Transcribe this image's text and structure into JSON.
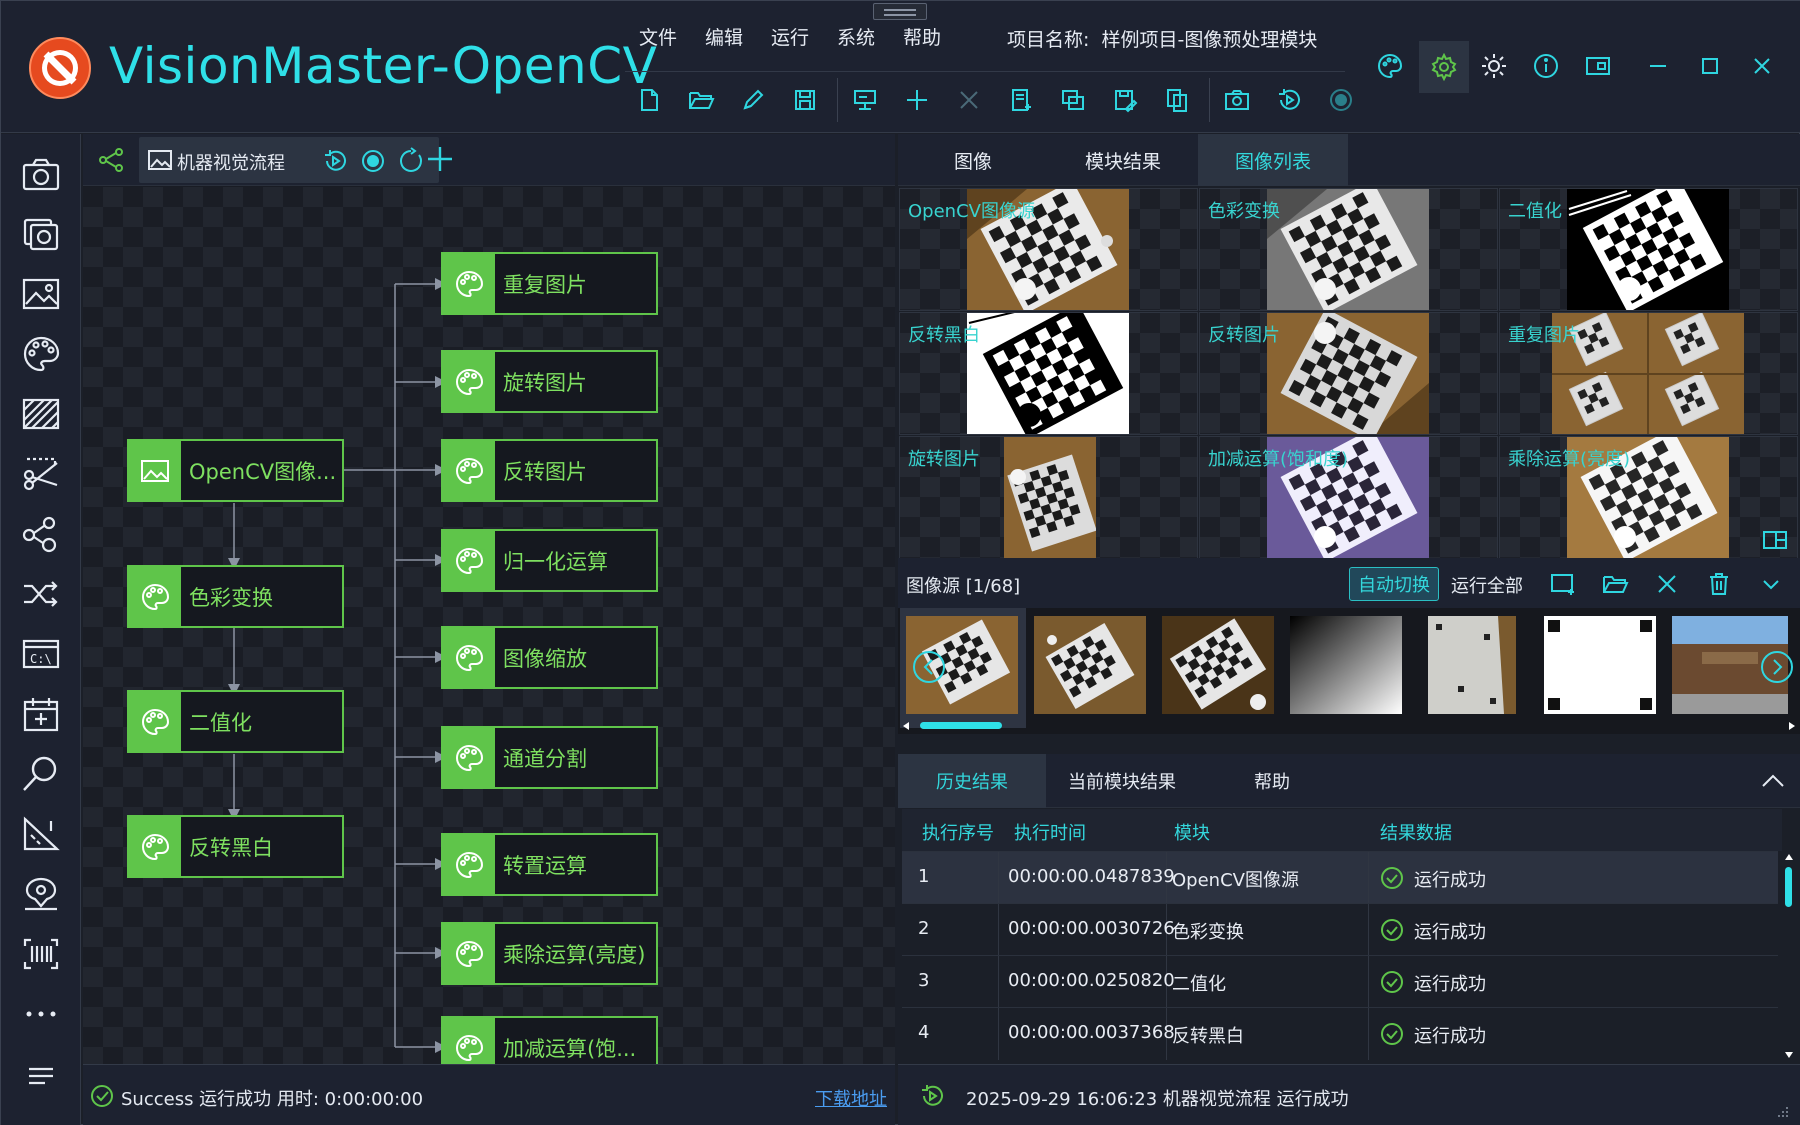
{
  "app": {
    "title": "VisionMaster-OpenCV"
  },
  "menu": [
    "文件",
    "编辑",
    "运行",
    "系统",
    "帮助"
  ],
  "project": {
    "label": "项目名称:",
    "name": "样例项目-图像预处理模块"
  },
  "toolbar_icons": [
    "new-file-icon",
    "open-folder-icon",
    "edit-pen-icon",
    "save-icon",
    "monitor-icon",
    "add-icon",
    "close-x-icon",
    "document-add-icon",
    "layers-icon",
    "save-as-icon",
    "copy-icon",
    "camera-icon",
    "run-loop-icon",
    "record-icon"
  ],
  "window_icons": [
    "palette-icon",
    "settings-icon",
    "theme-sun-icon",
    "info-icon",
    "layout-icon",
    "minimize-icon",
    "maximize-icon",
    "close-icon"
  ],
  "sidebar_icons": [
    "camera-icon",
    "multi-camera-icon",
    "image-icon",
    "palette-icon",
    "texture-icon",
    "crop-icon",
    "graph-icon",
    "shuffle-icon",
    "console-icon",
    "calendar-icon",
    "search-icon",
    "measure-icon",
    "location-icon",
    "barcode-icon",
    "more-icon",
    "menu-icon"
  ],
  "flow": {
    "tab_label": "机器视觉流程",
    "nodes": {
      "source": "OpenCV图像...",
      "left": [
        "色彩变换",
        "二值化",
        "反转黑白"
      ],
      "right": [
        "重复图片",
        "旋转图片",
        "反转图片",
        "归一化运算",
        "图像缩放",
        "通道分割",
        "转置运算",
        "乘除运算(亮度)",
        "加减运算(饱..."
      ]
    },
    "status": "Success 运行成功 用时: 0:00:00:00",
    "download_link": "下载地址"
  },
  "image_tabs": [
    "图像",
    "模块结果",
    "图像列表"
  ],
  "image_tab_active": 2,
  "image_grid": [
    "OpenCV图像源",
    "色彩变换",
    "二值化",
    "反转黑白",
    "反转图片",
    "重复图片",
    "旋转图片",
    "加减运算(饱和度)",
    "乘除运算(亮度)"
  ],
  "image_source": {
    "label": "图像源 [1/68]",
    "auto_switch": "自动切换",
    "run_all": "运行全部"
  },
  "result_tabs": [
    "历史结果",
    "当前模块结果",
    "帮助"
  ],
  "result_tab_active": 0,
  "table": {
    "columns": [
      "执行序号",
      "执行时间",
      "模块",
      "结果数据"
    ],
    "rows": [
      [
        "1",
        "00:00:00.0487839",
        "OpenCV图像源",
        "运行成功"
      ],
      [
        "2",
        "00:00:00.0030726",
        "色彩变换",
        "运行成功"
      ],
      [
        "3",
        "00:00:00.0250820",
        "二值化",
        "运行成功"
      ],
      [
        "4",
        "00:00:00.0037368",
        "反转黑白",
        "运行成功"
      ]
    ]
  },
  "bottom_status": "2025-09-29 16:06:23  机器视觉流程 运行成功",
  "colors": {
    "accent": "#2fe0e8",
    "node_green": "#5fc54a",
    "node_text": "#7ee060",
    "caption": "#38d3cf",
    "bg": "#1b1f28"
  }
}
